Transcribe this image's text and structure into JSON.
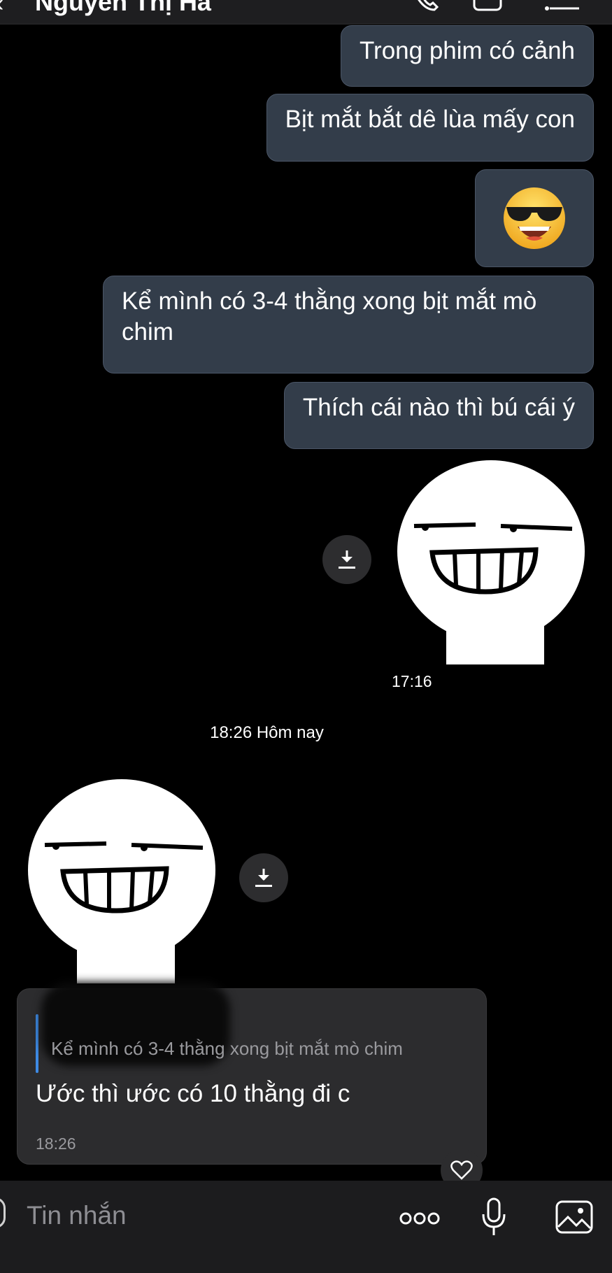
{
  "header": {
    "title": "Nguyễn Thị Hà",
    "back_icon": "chevron-left-icon",
    "actions": [
      "call-icon",
      "video-icon",
      "menu-icon"
    ]
  },
  "messages": [
    {
      "type": "text",
      "direction": "outgoing",
      "text": "Trong phim có cảnh"
    },
    {
      "type": "text",
      "direction": "outgoing",
      "text": "Bịt mắt bắt dê lùa mấy con"
    },
    {
      "type": "emoji",
      "direction": "outgoing",
      "emoji": "😎"
    },
    {
      "type": "text",
      "direction": "outgoing",
      "line1": "Kể mình có 3-4 thằng xong bịt mắt mò",
      "line2": "chim"
    },
    {
      "type": "text",
      "direction": "outgoing",
      "text": "Thích cái nào thì bú cái ý"
    },
    {
      "type": "sticker",
      "direction": "outgoing",
      "sticker": "smug-grin-sticker",
      "time": "17:16"
    },
    {
      "type": "separator",
      "label": "18:26 Hôm nay"
    },
    {
      "type": "sticker",
      "direction": "incoming",
      "sticker": "smug-grin-sticker"
    },
    {
      "type": "reply",
      "direction": "incoming",
      "quoted_text": "Kể mình có 3-4 thằng xong bịt mắt mò chim",
      "text": "Ước thì ước có 10 thằng đi c",
      "time": "18:26"
    }
  ],
  "composer": {
    "placeholder": "Tin nhắn",
    "icons": [
      "emoji-icon",
      "more-icon",
      "microphone-icon",
      "image-icon"
    ]
  },
  "colors": {
    "background": "#000000",
    "outgoing_bubble": "#333d4a",
    "incoming_bubble": "#2c2c2e",
    "quote_accent": "#3e8be5"
  }
}
